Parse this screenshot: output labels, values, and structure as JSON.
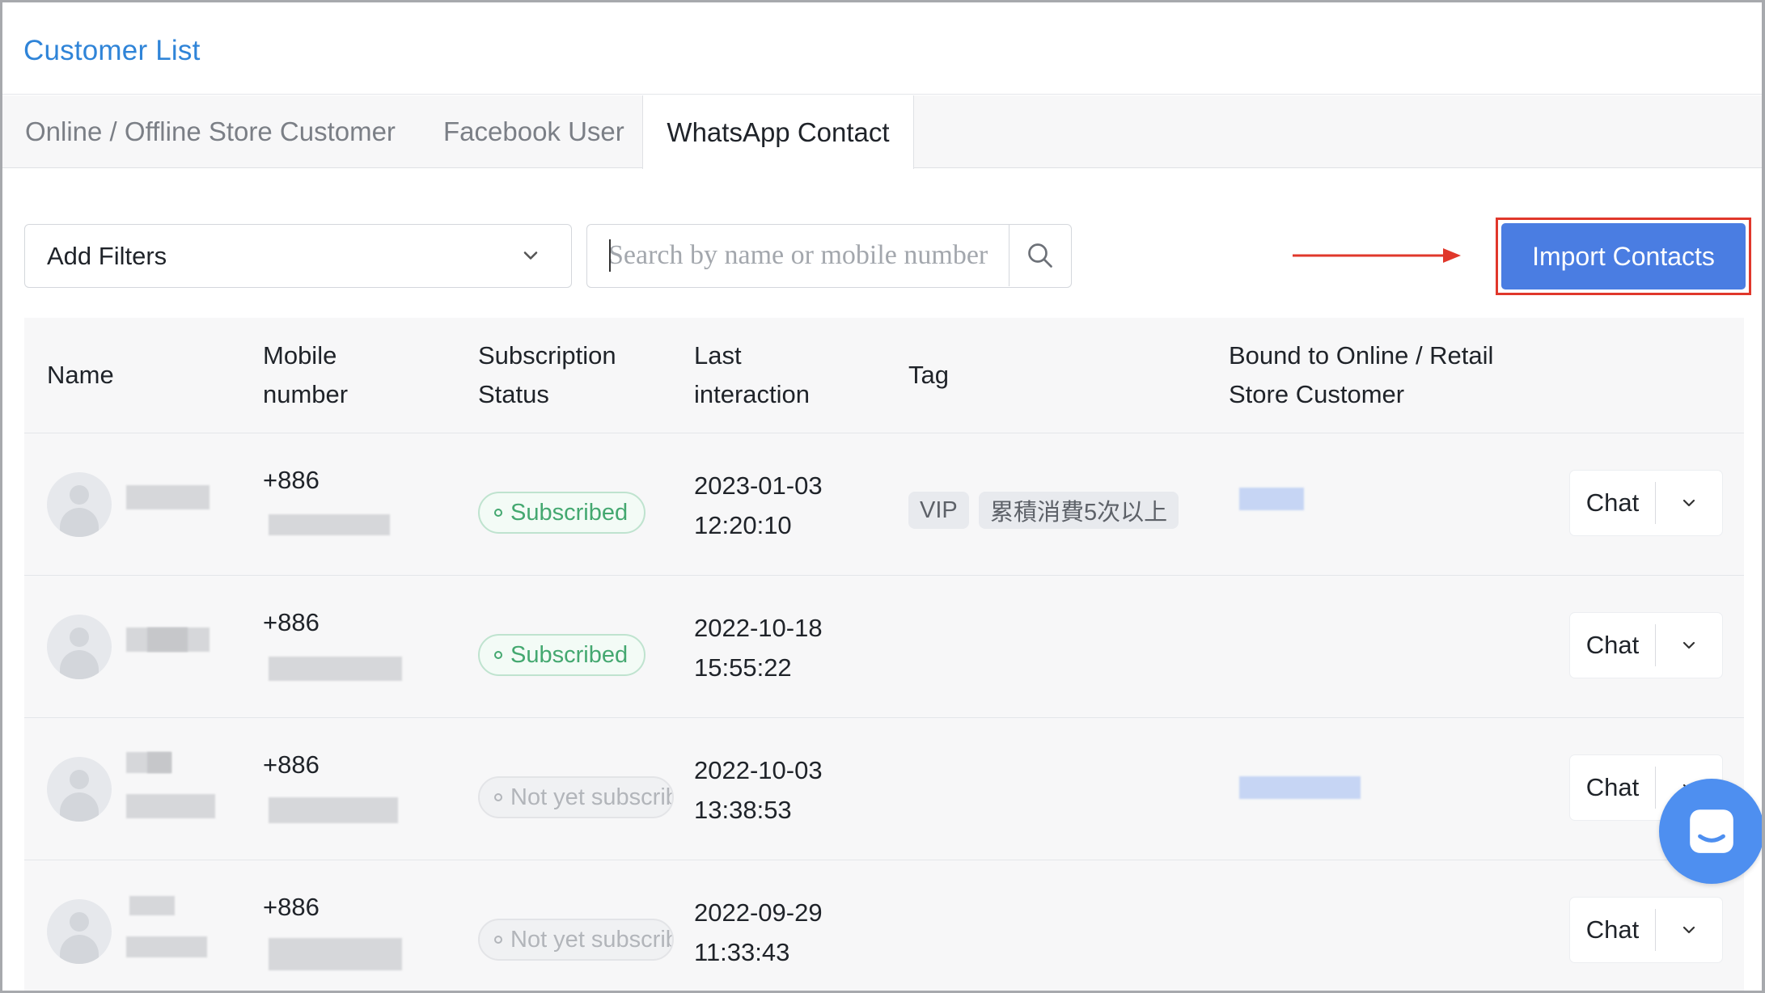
{
  "page": {
    "title": "Customer List"
  },
  "tabs": [
    {
      "label": "Online / Offline Store Customer",
      "active": false
    },
    {
      "label": "Facebook User",
      "active": false
    },
    {
      "label": "WhatsApp Contact",
      "active": true
    }
  ],
  "toolbar": {
    "filter_label": "Add Filters",
    "search_placeholder": "Search by name or mobile number",
    "search_value": "",
    "import_label": "Import Contacts",
    "highlight_color": "#e0372b",
    "accent_color": "#4a7de2"
  },
  "table": {
    "columns": [
      "Name",
      "Mobile number",
      "Subscription Status",
      "Last interaction",
      "Tag",
      "Bound to Online / Retail Store Customer"
    ],
    "rows": [
      {
        "phone_code": "+886",
        "status": "Subscribed",
        "status_type": "subscribed",
        "date": "2023-01-03",
        "time": "12:20:10",
        "tags": [
          "VIP",
          "累積消費5次以上"
        ],
        "bound": true,
        "chat_label": "Chat"
      },
      {
        "phone_code": "+886",
        "status": "Subscribed",
        "status_type": "subscribed",
        "date": "2022-10-18",
        "time": "15:55:22",
        "tags": [],
        "bound": false,
        "chat_label": "Chat"
      },
      {
        "phone_code": "+886",
        "status": "Not yet subscribed",
        "status_type": "pending",
        "date": "2022-10-03",
        "time": "13:38:53",
        "tags": [],
        "bound": true,
        "chat_label": "Chat"
      },
      {
        "phone_code": "+886",
        "status": "Not yet subscribed",
        "status_type": "pending",
        "date": "2022-09-29",
        "time": "11:33:43",
        "tags": [],
        "bound": false,
        "chat_label": "Chat"
      }
    ]
  },
  "icons": {
    "filter_dropdown": "chevron-down-icon",
    "search": "search-icon",
    "chat_dropdown": "chevron-down-icon",
    "avatar": "user-avatar-icon",
    "launcher": "chat-bubble-icon"
  }
}
